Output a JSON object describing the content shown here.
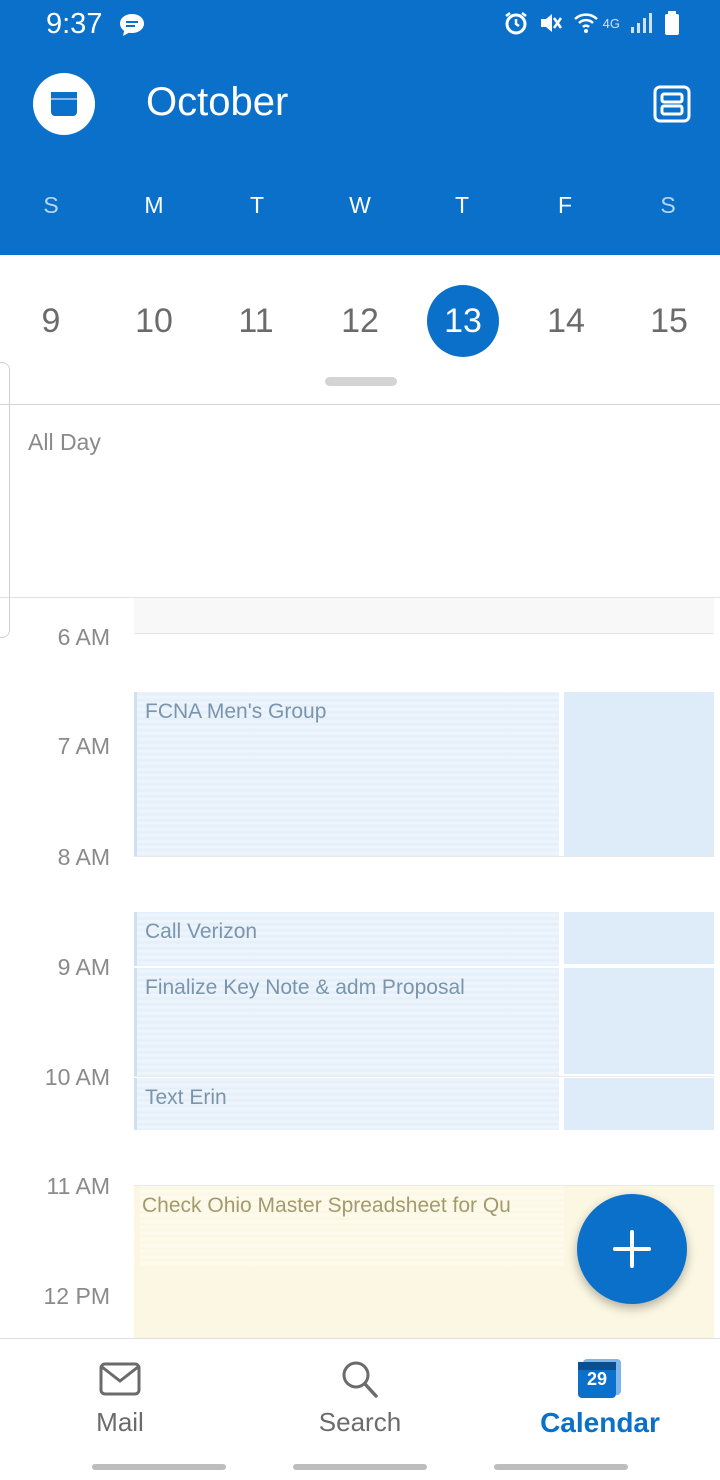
{
  "status_bar": {
    "time": "9:37",
    "network": "4G"
  },
  "header": {
    "title": "October",
    "weekdays": [
      "S",
      "M",
      "T",
      "W",
      "T",
      "F",
      "S"
    ]
  },
  "date_strip": {
    "dates": [
      "9",
      "10",
      "11",
      "12",
      "13",
      "14",
      "15"
    ],
    "selected": "13"
  },
  "all_day": {
    "label": "All Day"
  },
  "timeline": {
    "hours": [
      "6 AM",
      "7 AM",
      "8 AM",
      "9 AM",
      "10 AM",
      "11 AM",
      "12 PM"
    ],
    "events": [
      {
        "title": "FCNA Men's Group"
      },
      {
        "title": "Call Verizon"
      },
      {
        "title": "Finalize Key Note & adm Proposal"
      },
      {
        "title": "Text Erin"
      },
      {
        "title": "Check Ohio Master Spreadsheet for Qu"
      }
    ]
  },
  "bottom_nav": {
    "mail": "Mail",
    "search": "Search",
    "calendar": "Calendar",
    "calendar_badge": "29"
  },
  "colors": {
    "primary": "#0a70c9",
    "event_blue": "#deebf8",
    "event_yellow": "#fbf7e2"
  }
}
